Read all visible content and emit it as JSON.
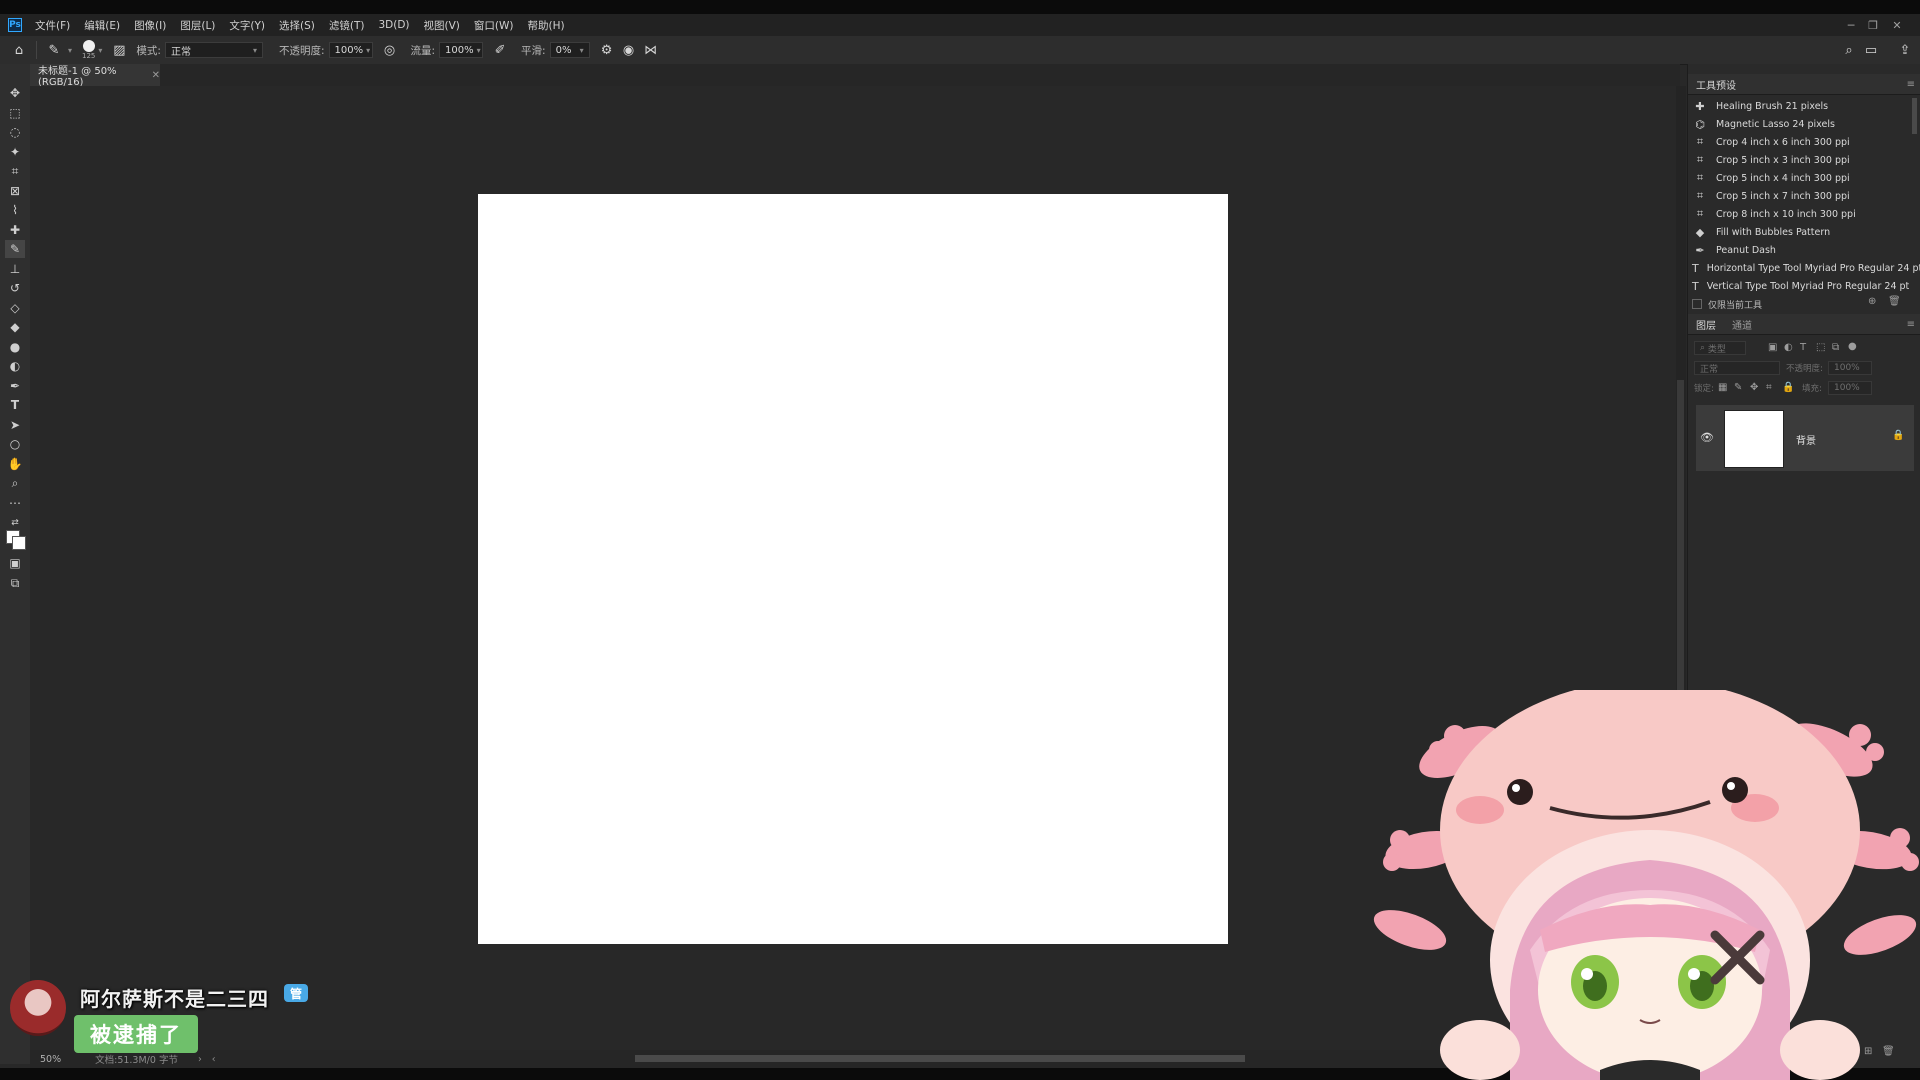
{
  "menubar": {
    "logo": "Ps",
    "items": [
      "文件(F)",
      "编辑(E)",
      "图像(I)",
      "图层(L)",
      "文字(Y)",
      "选择(S)",
      "滤镜(T)",
      "3D(D)",
      "视图(V)",
      "窗口(W)",
      "帮助(H)"
    ]
  },
  "options": {
    "brush_size": "125",
    "mode_label": "模式:",
    "mode_value": "正常",
    "opacity_label": "不透明度:",
    "opacity_value": "100%",
    "flow_label": "流量:",
    "flow_value": "100%",
    "smooth_label": "平滑:",
    "smooth_value": "0%"
  },
  "document": {
    "tab_title": "未标题-1 @ 50%(RGB/16)",
    "zoom": "50%",
    "doc_info": "文档:51.3M/0 字节"
  },
  "tool_presets": {
    "title": "工具预设",
    "items": [
      "Healing Brush 21 pixels",
      "Magnetic Lasso 24 pixels",
      "Crop 4 inch x 6 inch 300 ppi",
      "Crop 5 inch x 3 inch 300 ppi",
      "Crop 5 inch x 4 inch 300 ppi",
      "Crop 5 inch x 7 inch 300 ppi",
      "Crop 8 inch x 10 inch 300 ppi",
      "Fill with Bubbles Pattern",
      "Peanut Dash",
      "Horizontal Type Tool Myriad Pro Regular 24 pt",
      "Vertical Type Tool Myriad Pro Regular 24 pt"
    ],
    "current_only": "仅限当前工具"
  },
  "layers": {
    "tab_layers": "图层",
    "tab_channels": "通道",
    "search_placeholder": "类型",
    "blend_mode": "正常",
    "opacity_label": "不透明度:",
    "opacity_value": "100%",
    "lock_label": "锁定:",
    "fill_label": "填充:",
    "fill_value": "100%",
    "layer_name": "背景"
  },
  "stream": {
    "username": "阿尔萨斯不是二三四",
    "badge": "管",
    "message": "被逮捕了"
  },
  "colors": {
    "accent": "#31a8ff",
    "canvas": "#ffffff",
    "message_bg": "#6fc06b",
    "badge_bg": "#49a9e6"
  }
}
